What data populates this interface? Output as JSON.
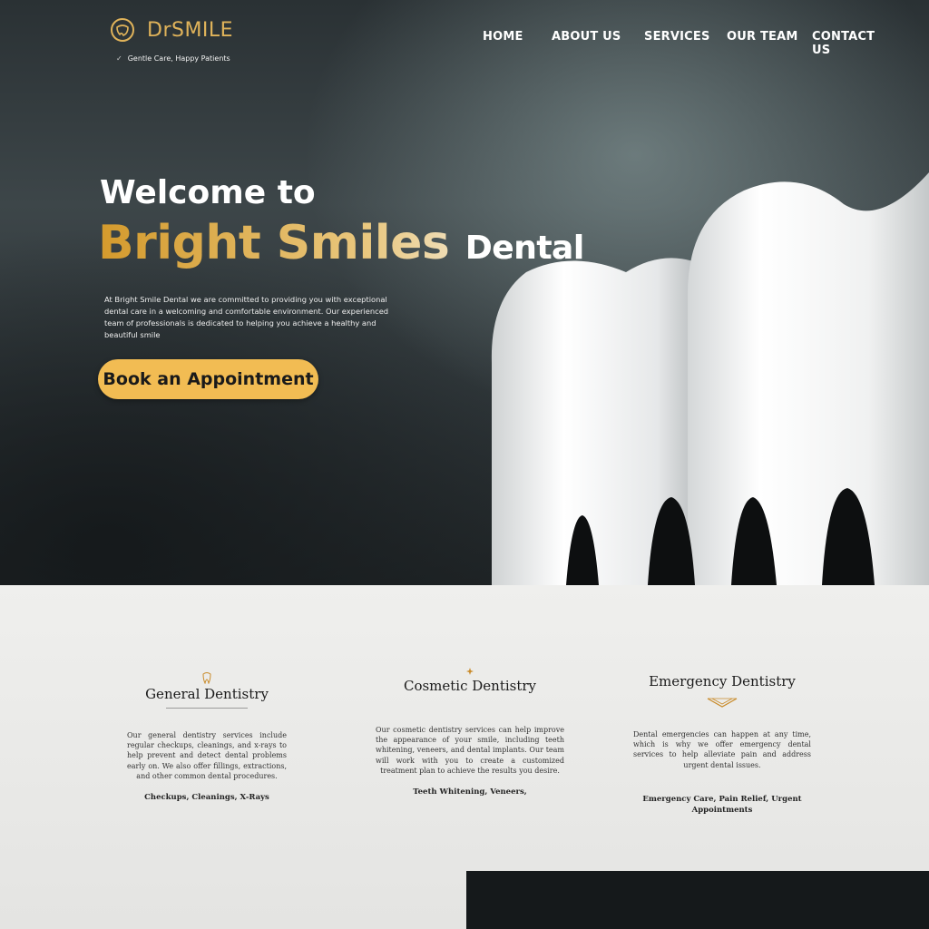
{
  "brand": {
    "name": "DrSMILE",
    "tagline": "Gentle Care, Happy Patients",
    "accent": "#e0b35a"
  },
  "nav": {
    "items": [
      "HOME",
      "ABOUT US",
      "SERVICES",
      "OUR TEAM",
      "CONTACT US"
    ]
  },
  "hero": {
    "welcome": "Welcome to",
    "headline_main": "Bright Smiles ",
    "headline_dental": "Dental",
    "intro": "At Bright Smile Dental we are committed to providing you with exceptional dental care in a welcoming and comfortable environment. Our experienced team of professionals is dedicated to helping you achieve a healthy and beautiful smile",
    "cta_label": "Book an Appointment",
    "cta_color": "#f2bc53"
  },
  "services": [
    {
      "title": "General Dentistry",
      "icon": "tooth-outline-icon",
      "desc": "Our general dentistry services include regular checkups, cleanings, and x-rays to help prevent and detect dental problems early on. We also offer fillings, extractions, and other common dental procedures.",
      "tags": "Checkups, Cleanings, X-Rays"
    },
    {
      "title": "Cosmetic Dentistry",
      "icon": "sparkle-icon",
      "desc": "Our cosmetic dentistry services can help improve the appearance of your smile, including teeth whitening, veneers, and dental implants. Our team will work with you to create a customized treatment plan to achieve the results you desire.",
      "tags": "Teeth  Whitening,  Veneers,"
    },
    {
      "title": "Emergency Dentistry",
      "icon": "chevron-ornament-icon",
      "desc": "Dental emergencies can happen at any time, which is why we offer emergency dental services to help alleviate pain and address urgent dental issues.",
      "tags": "Emergency Care, Pain Relief, Urgent Appointments"
    }
  ]
}
